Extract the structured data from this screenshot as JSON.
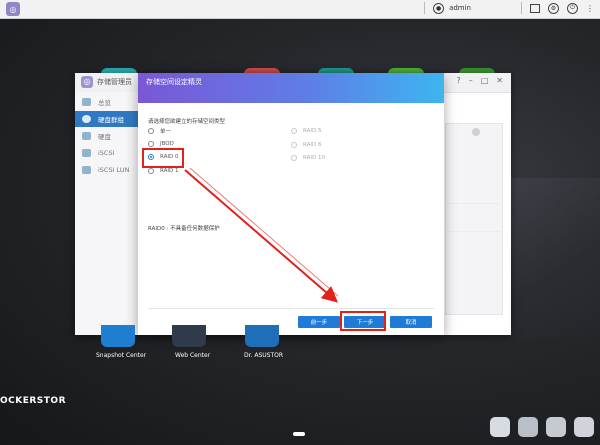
{
  "topbar": {
    "username": "admin"
  },
  "app_window": {
    "title": "存储管理员",
    "sidebar": [
      {
        "label": "总览"
      },
      {
        "label": "硬盘群组"
      },
      {
        "label": "硬盘"
      },
      {
        "label": "iSCSI"
      },
      {
        "label": "iSCSI LUN"
      }
    ]
  },
  "wizard": {
    "title": "存储空间设定精灵",
    "prompt": "请选择您欲建立的存储空间类型",
    "options_left": [
      {
        "label": "单一",
        "checked": false
      },
      {
        "label": "JBOD",
        "checked": false
      },
      {
        "label": "RAID 0",
        "checked": true
      },
      {
        "label": "RAID 1",
        "checked": false
      }
    ],
    "options_right": [
      {
        "label": "RAID 5"
      },
      {
        "label": "RAID 6"
      },
      {
        "label": "RAID 10"
      }
    ],
    "description": "RAID0 : 不具备任何数据保护",
    "buttons": {
      "prev": "前一步",
      "next": "下一步",
      "cancel": "取消"
    }
  },
  "dock": [
    {
      "label": "Snapshot Center"
    },
    {
      "label": "Web Center"
    },
    {
      "label": "Dr. ASUSTOR"
    }
  ],
  "brand": "OCKERSTOR",
  "colors": {
    "accent": "#1f7bd6",
    "highlight": "#e0221b",
    "header_start": "#7a57d6",
    "header_end": "#3db5f0"
  }
}
